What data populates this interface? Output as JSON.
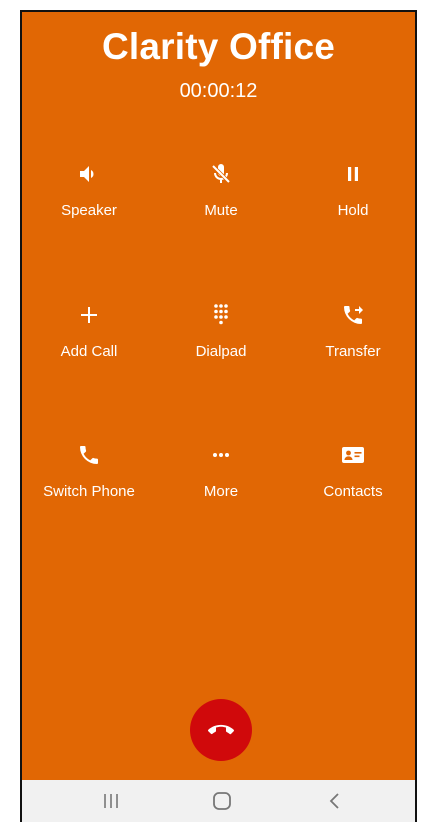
{
  "call": {
    "contact_name": "Clarity Office",
    "duration": "00:00:12"
  },
  "controls": [
    {
      "label": "Speaker",
      "icon": "speaker-icon"
    },
    {
      "label": "Mute",
      "icon": "mic-off-icon"
    },
    {
      "label": "Hold",
      "icon": "pause-icon"
    },
    {
      "label": "Add Call",
      "icon": "plus-icon"
    },
    {
      "label": "Dialpad",
      "icon": "dialpad-icon"
    },
    {
      "label": "Transfer",
      "icon": "phone-forward-icon"
    },
    {
      "label": "Switch Phone",
      "icon": "phone-icon"
    },
    {
      "label": "More",
      "icon": "more-dots-icon"
    },
    {
      "label": "Contacts",
      "icon": "contact-card-icon"
    }
  ],
  "end_call": {
    "icon": "end-call-icon"
  },
  "nav": {
    "recent_apps_icon": "recent-apps-icon",
    "home_icon": "home-icon",
    "back_icon": "back-icon"
  },
  "colors": {
    "background": "#e16704",
    "end_call": "#d0090b",
    "text": "#ffffff",
    "navbar": "#f1f1f1"
  }
}
